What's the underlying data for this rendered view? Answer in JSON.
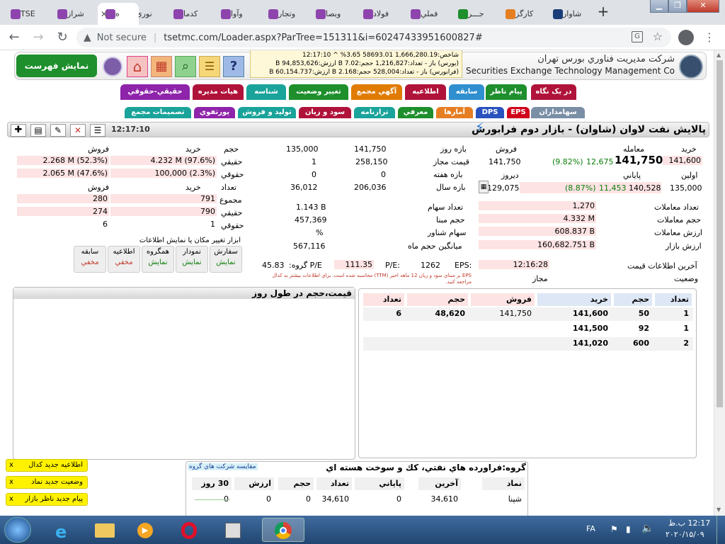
{
  "browser": {
    "tabs": [
      {
        "label": "شاوار",
        "color": "#1a3d7a"
      },
      {
        "label": "کارگز",
        "color": "#e67e22"
      },
      {
        "label": "جـــر",
        "color": "#1e8f2c"
      },
      {
        "label": "فملي",
        "color": "#8e44ad"
      },
      {
        "label": "فولاد",
        "color": "#8e44ad"
      },
      {
        "label": "وبصا",
        "color": "#8e44ad"
      },
      {
        "label": "وتجار",
        "color": "#8e44ad"
      },
      {
        "label": "وآوا",
        "color": "#8e44ad"
      },
      {
        "label": "کدما",
        "color": "#8e44ad"
      },
      {
        "label": "نوري",
        "color": "#8e44ad"
      },
      {
        "label": "ه",
        "color": "#8e44ad"
      },
      {
        "label": "شراز",
        "color": "#8e44ad"
      },
      {
        "label": "TSE",
        "color": "#8e44ad"
      }
    ],
    "new_tab": "+",
    "security": "Not secure",
    "url": "tsetmc.com/Loader.aspx?ParTree=151311&i=60247433951600827#"
  },
  "header": {
    "org_fa": "شرکت مديريت فناوري بورس تهران",
    "org_en": "Securities Exchange Technology Management Co",
    "show_list": "نمايش فهرست",
    "ticker_line1": "شاخص:1,666,280.19 58693.01 3.65% ^ 12:17:10",
    "ticker_line2": "(بورس) باز - تعداد:1,216,827 حجم:7.02 B ارزش:94,853,626 B",
    "ticker_line3": "(فرابورس) باز - تعداد:528,004 حجم:2.168 B ارزش:60,154.737 B"
  },
  "menu": {
    "row1": [
      {
        "label": "در يک نگاه",
        "color": "#b0133a"
      },
      {
        "label": "پيام ناظر",
        "color": "#1e8f2c"
      },
      {
        "label": "سابقه",
        "color": "#2f8fcf"
      },
      {
        "label": "اطلاعيه",
        "color": "#b0133a"
      },
      {
        "label": "آگهي مجمع",
        "color": "#e07b00"
      },
      {
        "label": "تغيير وضعيت",
        "color": "#1e8f2c"
      },
      {
        "label": "شناسه",
        "color": "#1aa39a"
      },
      {
        "label": "هيات مديره",
        "color": "#b0133a"
      },
      {
        "label": "حقيقي-حقوقي",
        "color": "#8e24aa"
      }
    ],
    "row2": [
      {
        "label": "سهامداران",
        "color": "#7a8fa6"
      },
      {
        "label": "EPS",
        "color": "#d0021b"
      },
      {
        "label": "DPS",
        "color": "#2a52be"
      },
      {
        "label": "آمارها",
        "color": "#e67e22"
      },
      {
        "label": "معرفي",
        "color": "#1e8f2c"
      },
      {
        "label": "ترازنامه",
        "color": "#1aa39a"
      },
      {
        "label": "سود و زيان",
        "color": "#b0133a"
      },
      {
        "label": "توليد و فروش",
        "color": "#1aa39a"
      },
      {
        "label": "پورتفوي",
        "color": "#8e24aa"
      },
      {
        "label": "تصميمات مجمع",
        "color": "#1aa39a"
      }
    ]
  },
  "symbol": {
    "title": "پالايش نفت لاوان (شاوان) - بازار دوم فرابورس",
    "time": "12:17:10"
  },
  "prices": {
    "labels": {
      "buy": "خريد",
      "trade": "معامله",
      "sell": "فروش",
      "range_day": "بازه روز",
      "first": "اولين",
      "closing": "پاياني",
      "yesterday": "ديروز",
      "allowed": "قيمت مجاز",
      "range_week": "بازه هفته",
      "range_year": "بازه سال"
    },
    "buy": "141,600",
    "trade": "141,750",
    "trade_change": "12,675",
    "trade_pct": "(9.82%)",
    "sell": "141,750",
    "first": "135,000",
    "closing": "140,528",
    "closing_change": "11,453",
    "closing_pct": "(8.87%)",
    "yesterday": "129,075",
    "day_hi": "141,750",
    "day_lo": "135,000",
    "allowed_hi": "258,150",
    "allowed_lo": "1",
    "week_hi": "0",
    "week_lo": "0",
    "year_hi": "206,036",
    "year_lo": "36,012"
  },
  "stats": {
    "labels": {
      "trades": "تعداد معاملات",
      "volume": "حجم معاملات",
      "value": "ارزش معاملات",
      "mcap": "ارزش بازار",
      "shares": "تعداد سهام",
      "base_vol": "حجم مبنا",
      "float": "سهام شناور",
      "avg_month": "ميانگين حجم ماه"
    },
    "trades": "1,270",
    "volume": "4.332 M",
    "value": "608.837 B",
    "mcap": "160,682.751 B",
    "shares": "1.143 B",
    "base_vol": "457,369",
    "float": "%",
    "avg_month": "567,116"
  },
  "info": {
    "last_update_label": "آخرين اطلاعات قيمت",
    "last_update": "12:16:28",
    "status_label": "وضعيت",
    "status": "مجاز",
    "eps_label": "EPS:",
    "eps": "1262",
    "pe_label": "P/E:",
    "pe": "111.35",
    "gpe_label": "P/E گروه:",
    "gpe": "45.83",
    "eps_note": "EPS بر مبناي سود و زيان 12 ماهه اخير (TTM) محاسبه شده است. براي اطلاعات بيشتر به كدال مراجعه كنيد."
  },
  "client": {
    "h_volume": "حجم",
    "h_buy": "خريد",
    "h_sell": "فروش",
    "l_real": "حقيقي",
    "l_legal": "حقوقي",
    "h_count": "تعداد",
    "l_sum": "مجموع",
    "real_buy": "4.232 M (97.6%)",
    "real_sell": "2.268 M (52.3%)",
    "legal_buy": "100,000 (2.3%)",
    "legal_sell": "2.065 M (47.6%)",
    "sum_buy": "791",
    "sum_sell": "280",
    "real_cnt_buy": "790",
    "real_cnt_sell": "274",
    "legal_cnt_buy": "1",
    "legal_cnt_sell": "6"
  },
  "tools": {
    "title": "ابزار تغيير مکان يا نمايش اطلاعات",
    "items": [
      {
        "label": "سفارش",
        "state": "نمايش",
        "on": true
      },
      {
        "label": "نمودار",
        "state": "نمايش",
        "on": true
      },
      {
        "label": "همگروه",
        "state": "نمايش",
        "on": true
      },
      {
        "label": "اطلاعيه",
        "state": "مخفي",
        "on": false
      },
      {
        "label": "سابقه",
        "state": "مخفي",
        "on": false
      }
    ]
  },
  "orderbook": {
    "headers": [
      "تعداد",
      "حجم",
      "خريد",
      "فروش",
      "حجم",
      "تعداد"
    ],
    "rows": [
      [
        "1",
        "50",
        "141,600",
        "141,750",
        "48,620",
        "6"
      ],
      [
        "1",
        "92",
        "141,500",
        "",
        "",
        ""
      ],
      [
        "2",
        "600",
        "141,020",
        "",
        "",
        ""
      ]
    ]
  },
  "chart_panel": {
    "title": "قيمت،حجم در طول روز"
  },
  "group": {
    "title": "گروه:فراورده هاي نفتي، كك و سوخت هسته اي",
    "compare": "مقايسه شرکت هاي گروه",
    "headers": [
      "نماد",
      "آخرين",
      "پاياني",
      "تعداد",
      "حجم",
      "ارزش",
      "30 روز"
    ],
    "rows": [
      [
        "شپنا",
        "34,610",
        "0",
        "34,610",
        "0",
        "0",
        "0"
      ]
    ]
  },
  "notices": [
    "اطلاعيه جديد کدال",
    "وضعيت جديد نماد",
    "پيام جديد ناظر بازار"
  ],
  "taskbar": {
    "lang": "FA",
    "time": "12:17 ب.ظ",
    "date": "۲۰۲۰/۱۵/۰۹"
  }
}
